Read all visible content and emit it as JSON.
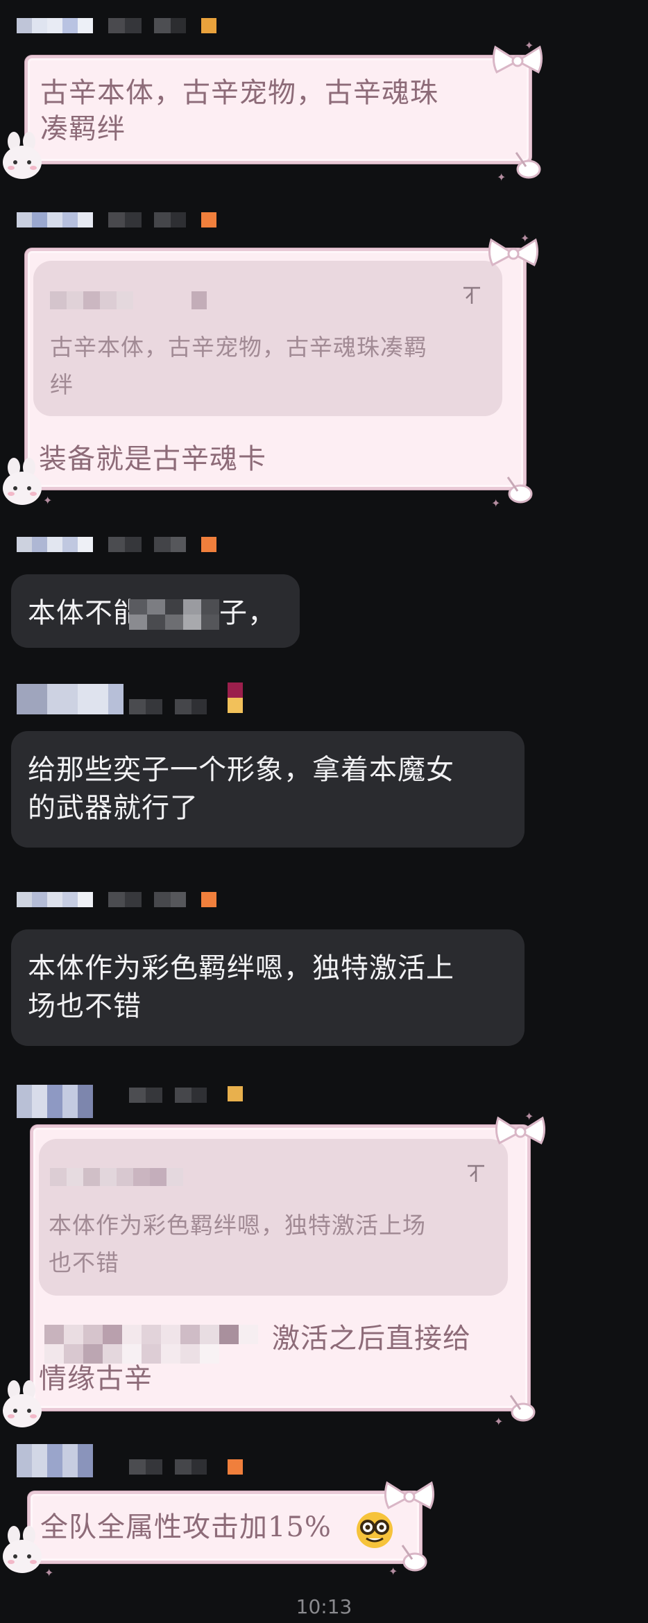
{
  "messages": [
    {
      "type": "pink",
      "text": "古辛本体，古辛宠物，古辛魂珠\n凑羁绊"
    },
    {
      "type": "pink-quote",
      "quote": "古辛本体，古辛宠物，古辛魂珠凑羁\n绊",
      "text": "装备就是古辛魂卡"
    },
    {
      "type": "dark",
      "text_start": "本体不能",
      "text_end": "子，"
    },
    {
      "type": "dark",
      "text": "给那些奕子一个形象，拿着本魔女\n的武器就行了"
    },
    {
      "type": "dark",
      "text": "本体作为彩色羁绊嗯，独特激活上\n场也不错"
    },
    {
      "type": "pink-quote",
      "quote": "本体作为彩色羁绊嗯，独特激活上场\n也不错",
      "text_tail": "激活之后直接给",
      "text_line2": "情缘古辛"
    },
    {
      "type": "pink",
      "text": "全队全属性攻击加15%"
    }
  ],
  "status": {
    "time": "10:13"
  },
  "icons": {
    "quote_pin": "collapse-quote-icon",
    "emoji": "nerd-face-emoji"
  },
  "colors": {
    "background": "#0f1012",
    "pink_bubble": "#fdeef3",
    "pink_text": "#8d6b78",
    "dark_bubble": "#2a2b2f",
    "badge_orange": "#f07f3c",
    "badge_gold": "#e8b04d",
    "badge_wine": "#9b1f4c"
  }
}
